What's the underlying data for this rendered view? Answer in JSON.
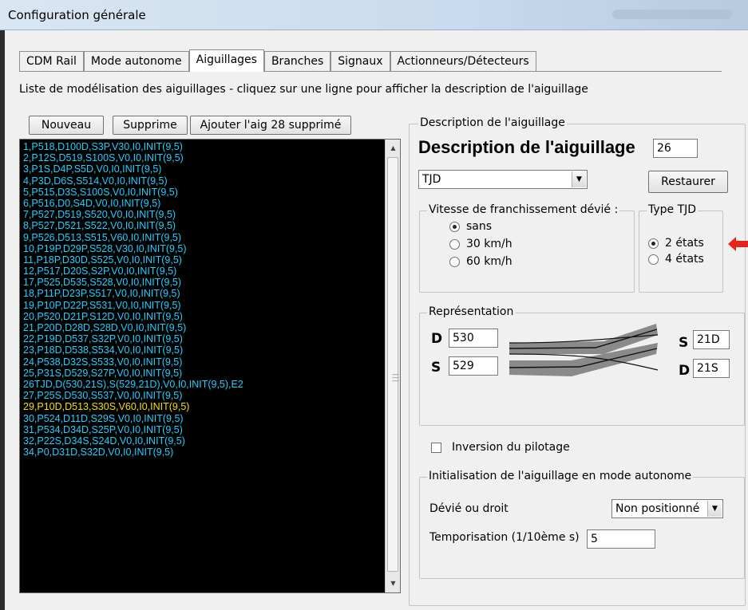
{
  "window": {
    "title": "Configuration générale"
  },
  "tabs": [
    "CDM Rail",
    "Mode autonome",
    "Aiguillages",
    "Branches",
    "Signaux",
    "Actionneurs/Détecteurs"
  ],
  "hint": "Liste de modélisation des aiguillages - cliquez sur une ligne pour afficher la description de l'aiguillage",
  "toolbar": {
    "new": "Nouveau",
    "delete": "Supprime",
    "add_deleted": "Ajouter l'aig 28 supprimé"
  },
  "list": {
    "selected_index": 23,
    "rows": [
      "1,P518,D100D,S3P,V30,I0,INIT(9,5)",
      "2,P12S,D519,S100S,V0,I0,INIT(9,5)",
      "3,P1S,D4P,S5D,V0,I0,INIT(9,5)",
      "4,P3D,D6S,S514,V0,I0,INIT(9,5)",
      "5,P515,D3S,S100S,V0,I0,INIT(9,5)",
      "6,P516,D0,S4D,V0,I0,INIT(9,5)",
      "7,P527,D519,S520,V0,I0,INIT(9,5)",
      "8,P527,D521,S522,V0,I0,INIT(9,5)",
      "9,P526,D513,S515,V60,I0,INIT(9,5)",
      "10,P19P,D29P,S528,V30,I0,INIT(9,5)",
      "11,P18P,D30D,S525,V0,I0,INIT(9,5)",
      "12,P517,D20S,S2P,V0,I0,INIT(9,5)",
      "17,P525,D535,S528,V0,I0,INIT(9,5)",
      "18,P11P,D23P,S517,V0,I0,INIT(9,5)",
      "19,P10P,D22P,S531,V0,I0,INIT(9,5)",
      "20,P520,D21P,S12D,V0,I0,INIT(9,5)",
      "21,P20D,D28D,S28D,V0,I0,INIT(9,5)",
      "22,P19D,D537,S32P,V0,I0,INIT(9,5)",
      "23,P18D,D538,S534,V0,I0,INIT(9,5)",
      "24,P538,D32S,S533,V0,I0,INIT(9,5)",
      "25,P31S,D529,S27P,V0,I0,INIT(9,5)",
      "26TJD,D(530,21S),S(529,21D),V0,I0,INIT(9,5),E2",
      "27,P25S,D530,S537,V0,I0,INIT(9,5)",
      "29,P10D,D513,S30S,V60,I0,INIT(9,5)",
      "30,P524,D11D,S29S,V0,I0,INIT(9,5)",
      "31,P534,D34D,S25P,V0,I0,INIT(9,5)",
      "32,P22S,D34S,S24D,V0,I0,INIT(9,5)",
      "34,P0,D31D,S32D,V0,I0,INIT(9,5)"
    ]
  },
  "desc": {
    "group_label": "Description de l'aiguillage",
    "title": "Description de l'aiguillage",
    "number": "26",
    "type": "TJD",
    "restore": "Restaurer",
    "speed_label": "Vitesse de franchissement dévié :",
    "speeds": [
      "sans",
      "30 km/h",
      "60 km/h"
    ],
    "tjd_label": "Type TJD",
    "tjd_types": [
      "2 états",
      "4 états"
    ],
    "repr_label": "Représentation",
    "d_letter": "D",
    "s_letter": "S",
    "d_left": "530",
    "s_left": "529",
    "s_right": "21D",
    "d_right": "21S",
    "inversion": "Inversion du pilotage",
    "init_label": "Initialisation de l'aiguillage en mode autonome",
    "devie_label": "Dévié ou droit",
    "devie_value": "Non positionné",
    "tempo_label": "Temporisation  (1/10ème s)",
    "tempo_value": "5"
  },
  "colors": {
    "list_bg": "#000000",
    "list_text": "#1fd0ff",
    "list_selected": "#f0e000",
    "arrow": "#e8231c"
  }
}
